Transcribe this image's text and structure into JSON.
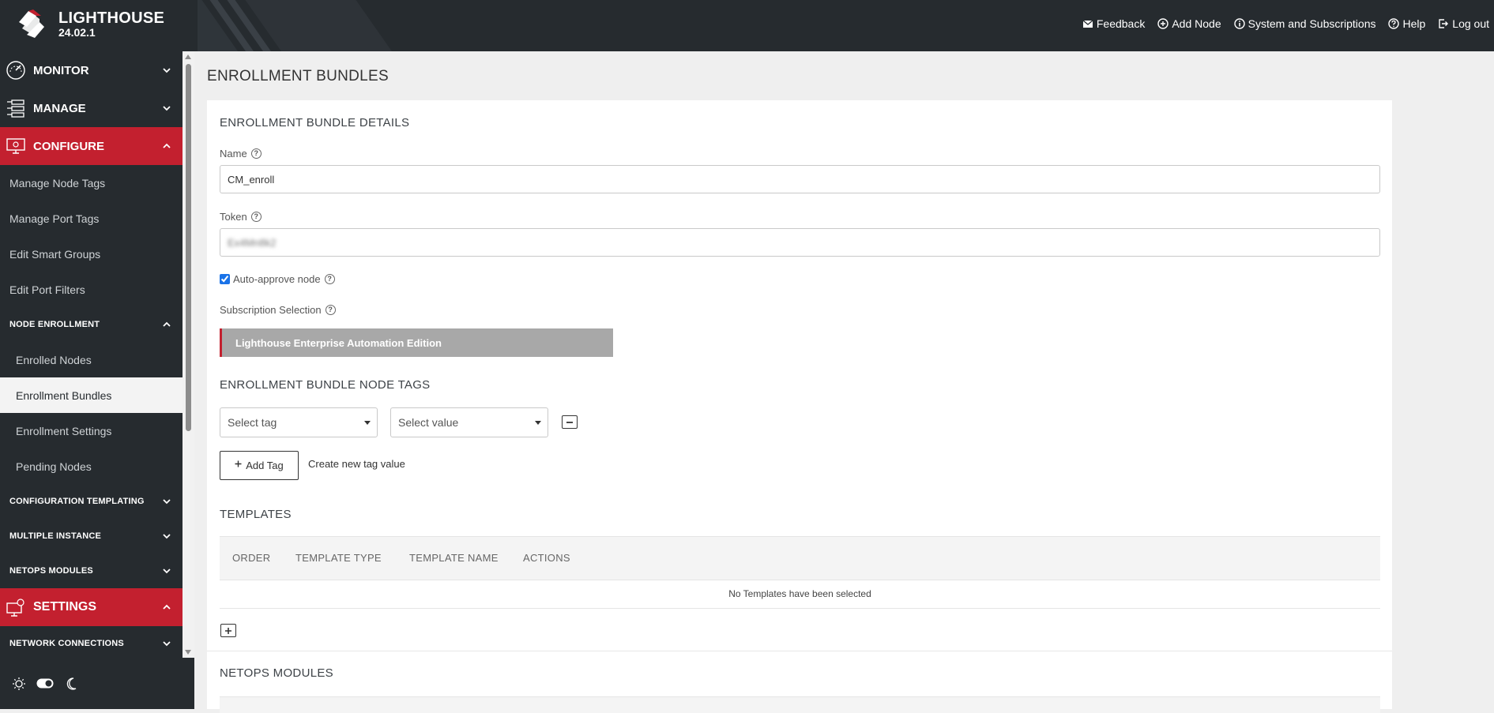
{
  "app": {
    "name": "LIGHTHOUSE",
    "version": "24.02.1"
  },
  "topnav": [
    {
      "label": "Feedback",
      "icon": "envelope-icon"
    },
    {
      "label": "Add Node",
      "icon": "plus-circle-icon"
    },
    {
      "label": "System and Subscriptions",
      "icon": "info-circle-icon"
    },
    {
      "label": "Help",
      "icon": "question-circle-icon"
    },
    {
      "label": "Log out",
      "icon": "logout-icon"
    }
  ],
  "sidebar": {
    "monitor": "MONITOR",
    "manage": "MANAGE",
    "configure": "CONFIGURE",
    "configure_items": [
      "Manage Node Tags",
      "Manage Port Tags",
      "Edit Smart Groups",
      "Edit Port Filters"
    ],
    "node_enrollment": "NODE ENROLLMENT",
    "enrollment_items": [
      "Enrolled Nodes",
      "Enrollment Bundles",
      "Enrollment Settings",
      "Pending Nodes"
    ],
    "config_templating": "CONFIGURATION TEMPLATING",
    "multiple_instance": "MULTIPLE INSTANCE",
    "netops_modules": "NETOPS MODULES",
    "settings": "SETTINGS",
    "network_connections": "NETWORK CONNECTIONS"
  },
  "main": {
    "page_title": "ENROLLMENT BUNDLES",
    "details_title": "ENROLLMENT BUNDLE DETAILS",
    "name_label": "Name",
    "name_value": "CM_enroll",
    "token_label": "Token",
    "token_value": "Ex4Mn8k2",
    "auto_approve_label": "Auto-approve node",
    "auto_approve_checked": true,
    "subscription_label": "Subscription Selection",
    "subscription_value": "Lighthouse Enterprise Automation Edition",
    "node_tags_title": "ENROLLMENT BUNDLE NODE TAGS",
    "select_tag": "Select tag",
    "select_value": "Select value",
    "add_tag": "Add Tag",
    "create_tag_value": "Create new tag value",
    "templates_title": "TEMPLATES",
    "templates_columns": [
      "ORDER",
      "TEMPLATE TYPE",
      "TEMPLATE NAME",
      "ACTIONS"
    ],
    "templates_empty": "No Templates have been selected",
    "netops_title": "NETOPS MODULES"
  },
  "colors": {
    "accent": "#c3202f",
    "sidebar": "#262b2f",
    "subscription_bg": "#a8a8a8"
  }
}
